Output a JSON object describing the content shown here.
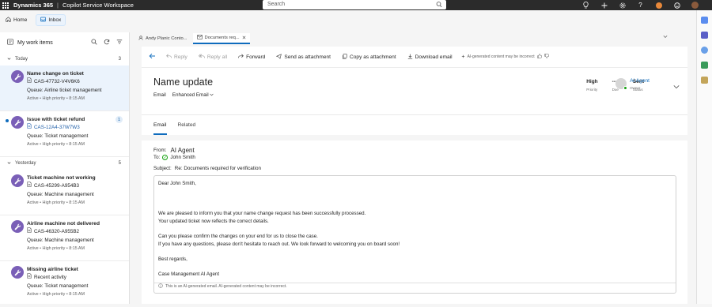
{
  "topbar": {
    "app_name": "Dynamics 365",
    "app_sub": "Copilot Service Workspace",
    "search_placeholder": "Search"
  },
  "nav": {
    "home_label": "Home",
    "inbox_label": "Inbox"
  },
  "left_panel": {
    "title": "My work items",
    "groups": [
      {
        "label": "Today",
        "count": "3",
        "items": [
          {
            "title": "Name change on ticket",
            "case": "CAS-47732-V4V6K6",
            "queue": "Queue: Airline ticket management",
            "meta": "Active  •  High priority  •  8:15 AM",
            "badge": ""
          },
          {
            "title": "Issue with ticket refund",
            "case": "CAS-12A4-37W7W3",
            "queue": "Queue: Ticket management",
            "meta": "Active  •  High priority  •  8:15 AM",
            "badge": "1"
          }
        ]
      },
      {
        "label": "Yesterday",
        "count": "5",
        "items": [
          {
            "title": "Ticket machine not working",
            "case": "CAS-45299-A954B3",
            "queue": "Queue: Machine management",
            "meta": "Active  •  High priority  •  8:15 AM",
            "badge": ""
          },
          {
            "title": "Airline machine not delivered",
            "case": "CAS-46320-A955B2",
            "queue": "Queue: Machine management",
            "meta": "Active  •  High priority  •  8:15 AM",
            "badge": ""
          },
          {
            "title": "Missing airline ticket",
            "case": "Recent activity",
            "queue": "Queue: Ticket management",
            "meta": "Active  •  High priority  •  8:15 AM",
            "badge": ""
          }
        ]
      }
    ]
  },
  "tabs": [
    {
      "label": "Andy Planic Conto..."
    },
    {
      "label": "Documents req..."
    }
  ],
  "commands": {
    "reply": "Reply",
    "reply_all": "Reply all",
    "forward": "Forward",
    "send_attachment": "Send as attachment",
    "copy_attachment": "Copy as attachment",
    "download": "Download email",
    "ai_notice": "AI-generated content may be incorrect"
  },
  "record": {
    "title": "Name update",
    "type": "Email",
    "form": "Enhanced Email",
    "priority_value": "High",
    "priority_label": "Priority",
    "due_value": "---",
    "due_label": "Due",
    "status_value": "Sent",
    "status_label": "Status",
    "owner_name": "AI Agent",
    "owner_label": "Owner"
  },
  "subtabs": {
    "email": "Email",
    "related": "Related"
  },
  "email": {
    "from_label": "From:",
    "from_value": "AI Agent",
    "to_label": "To:",
    "to_value": "John Smith",
    "subject_label": "Subject:",
    "subject_value": "Re: Documents required for verification",
    "body": {
      "greeting": "Dear John Smith,",
      "p1": "We are pleased to inform you that your name change request has been successfully processed.",
      "p2": "Your updated ticket now reflects the correct details.",
      "p3": "Can you please confirm the changes on your end for us to close the case.",
      "p4": "If you have any questions, please don't hesitate to reach out. We look forward to welcoming you on board soon!",
      "closing": "Best regards,",
      "signature": "Case Management AI Agent"
    },
    "footer_notice": "This is an AI-generated email. AI-generated content may be incorrect."
  }
}
